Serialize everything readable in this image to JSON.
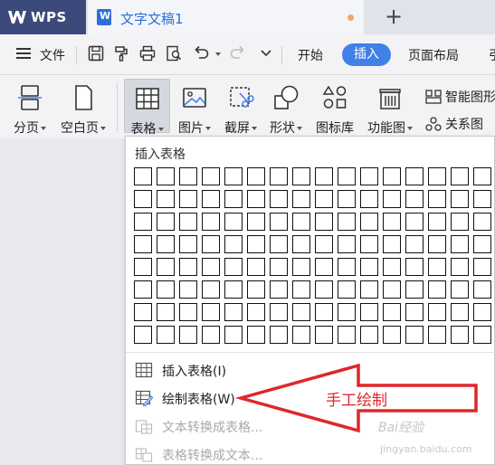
{
  "tabs": {
    "app_name": "WPS",
    "document_title": "文字文稿1",
    "new_tab": "+"
  },
  "menubar": {
    "file_label": "文件",
    "items": [
      "开始",
      "插入",
      "页面布局",
      "引"
    ],
    "active": "插入",
    "quick_icons": [
      "save-icon",
      "format-painter-icon",
      "print-icon",
      "print-preview-icon",
      "undo-icon",
      "redo-icon",
      "more-icon"
    ]
  },
  "ribbon": {
    "buttons": [
      {
        "label": "分页",
        "icon": "page-break-icon"
      },
      {
        "label": "空白页",
        "icon": "blank-page-icon"
      },
      {
        "label": "表格",
        "icon": "table-icon"
      },
      {
        "label": "图片",
        "icon": "picture-icon"
      },
      {
        "label": "截屏",
        "icon": "screenshot-icon"
      },
      {
        "label": "形状",
        "icon": "shape-icon"
      },
      {
        "label": "图标库",
        "icon": "icon-library-icon"
      },
      {
        "label": "功能图",
        "icon": "function-chart-icon"
      }
    ],
    "small_items": [
      "智能图形",
      "关系图"
    ]
  },
  "dropdown": {
    "title": "插入表格",
    "grid": {
      "columns": 16,
      "rows": 8
    },
    "items": [
      {
        "label": "插入表格(I)",
        "icon": "insert-table-icon",
        "enabled": true
      },
      {
        "label": "绘制表格(W)",
        "icon": "draw-table-icon",
        "enabled": true
      },
      {
        "label": "文本转换成表格...",
        "icon": "text-to-table-icon",
        "enabled": false
      },
      {
        "label": "表格转换成文本...",
        "icon": "table-to-text-icon",
        "enabled": false
      }
    ]
  },
  "annotation": {
    "text": "手工绘制",
    "color": "#e0262b"
  },
  "watermark": {
    "text": "Bai经验",
    "sub": "jingyan.baidu.com"
  },
  "colors": {
    "accent": "#3f81e6",
    "wps_tab": "#3b4a7a",
    "doc_title": "#2d6fd6"
  }
}
